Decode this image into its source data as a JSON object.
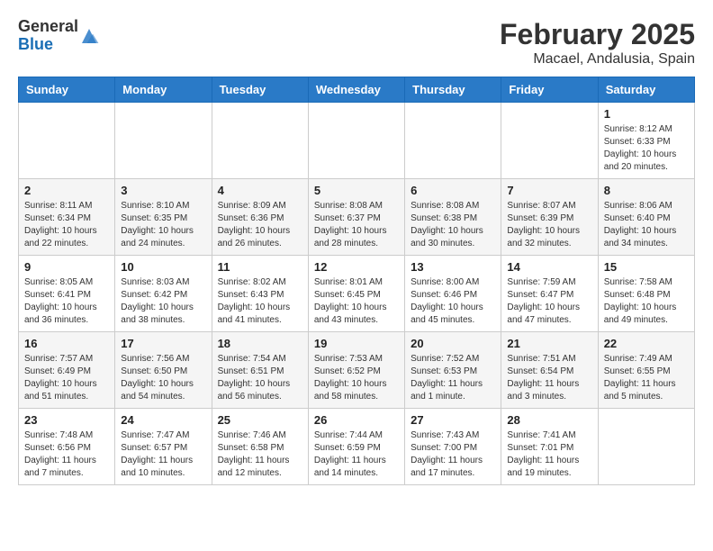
{
  "header": {
    "logo_general": "General",
    "logo_blue": "Blue",
    "month_year": "February 2025",
    "location": "Macael, Andalusia, Spain"
  },
  "weekdays": [
    "Sunday",
    "Monday",
    "Tuesday",
    "Wednesday",
    "Thursday",
    "Friday",
    "Saturday"
  ],
  "weeks": [
    [
      null,
      null,
      null,
      null,
      null,
      null,
      {
        "day": "1",
        "sunrise": "8:12 AM",
        "sunset": "6:33 PM",
        "daylight": "10 hours and 20 minutes."
      }
    ],
    [
      {
        "day": "2",
        "sunrise": "8:11 AM",
        "sunset": "6:34 PM",
        "daylight": "10 hours and 22 minutes."
      },
      {
        "day": "3",
        "sunrise": "8:10 AM",
        "sunset": "6:35 PM",
        "daylight": "10 hours and 24 minutes."
      },
      {
        "day": "4",
        "sunrise": "8:09 AM",
        "sunset": "6:36 PM",
        "daylight": "10 hours and 26 minutes."
      },
      {
        "day": "5",
        "sunrise": "8:08 AM",
        "sunset": "6:37 PM",
        "daylight": "10 hours and 28 minutes."
      },
      {
        "day": "6",
        "sunrise": "8:08 AM",
        "sunset": "6:38 PM",
        "daylight": "10 hours and 30 minutes."
      },
      {
        "day": "7",
        "sunrise": "8:07 AM",
        "sunset": "6:39 PM",
        "daylight": "10 hours and 32 minutes."
      },
      {
        "day": "8",
        "sunrise": "8:06 AM",
        "sunset": "6:40 PM",
        "daylight": "10 hours and 34 minutes."
      }
    ],
    [
      {
        "day": "9",
        "sunrise": "8:05 AM",
        "sunset": "6:41 PM",
        "daylight": "10 hours and 36 minutes."
      },
      {
        "day": "10",
        "sunrise": "8:03 AM",
        "sunset": "6:42 PM",
        "daylight": "10 hours and 38 minutes."
      },
      {
        "day": "11",
        "sunrise": "8:02 AM",
        "sunset": "6:43 PM",
        "daylight": "10 hours and 41 minutes."
      },
      {
        "day": "12",
        "sunrise": "8:01 AM",
        "sunset": "6:45 PM",
        "daylight": "10 hours and 43 minutes."
      },
      {
        "day": "13",
        "sunrise": "8:00 AM",
        "sunset": "6:46 PM",
        "daylight": "10 hours and 45 minutes."
      },
      {
        "day": "14",
        "sunrise": "7:59 AM",
        "sunset": "6:47 PM",
        "daylight": "10 hours and 47 minutes."
      },
      {
        "day": "15",
        "sunrise": "7:58 AM",
        "sunset": "6:48 PM",
        "daylight": "10 hours and 49 minutes."
      }
    ],
    [
      {
        "day": "16",
        "sunrise": "7:57 AM",
        "sunset": "6:49 PM",
        "daylight": "10 hours and 51 minutes."
      },
      {
        "day": "17",
        "sunrise": "7:56 AM",
        "sunset": "6:50 PM",
        "daylight": "10 hours and 54 minutes."
      },
      {
        "day": "18",
        "sunrise": "7:54 AM",
        "sunset": "6:51 PM",
        "daylight": "10 hours and 56 minutes."
      },
      {
        "day": "19",
        "sunrise": "7:53 AM",
        "sunset": "6:52 PM",
        "daylight": "10 hours and 58 minutes."
      },
      {
        "day": "20",
        "sunrise": "7:52 AM",
        "sunset": "6:53 PM",
        "daylight": "11 hours and 1 minute."
      },
      {
        "day": "21",
        "sunrise": "7:51 AM",
        "sunset": "6:54 PM",
        "daylight": "11 hours and 3 minutes."
      },
      {
        "day": "22",
        "sunrise": "7:49 AM",
        "sunset": "6:55 PM",
        "daylight": "11 hours and 5 minutes."
      }
    ],
    [
      {
        "day": "23",
        "sunrise": "7:48 AM",
        "sunset": "6:56 PM",
        "daylight": "11 hours and 7 minutes."
      },
      {
        "day": "24",
        "sunrise": "7:47 AM",
        "sunset": "6:57 PM",
        "daylight": "11 hours and 10 minutes."
      },
      {
        "day": "25",
        "sunrise": "7:46 AM",
        "sunset": "6:58 PM",
        "daylight": "11 hours and 12 minutes."
      },
      {
        "day": "26",
        "sunrise": "7:44 AM",
        "sunset": "6:59 PM",
        "daylight": "11 hours and 14 minutes."
      },
      {
        "day": "27",
        "sunrise": "7:43 AM",
        "sunset": "7:00 PM",
        "daylight": "11 hours and 17 minutes."
      },
      {
        "day": "28",
        "sunrise": "7:41 AM",
        "sunset": "7:01 PM",
        "daylight": "11 hours and 19 minutes."
      },
      null
    ]
  ],
  "labels": {
    "sunrise": "Sunrise:",
    "sunset": "Sunset:",
    "daylight": "Daylight:"
  }
}
